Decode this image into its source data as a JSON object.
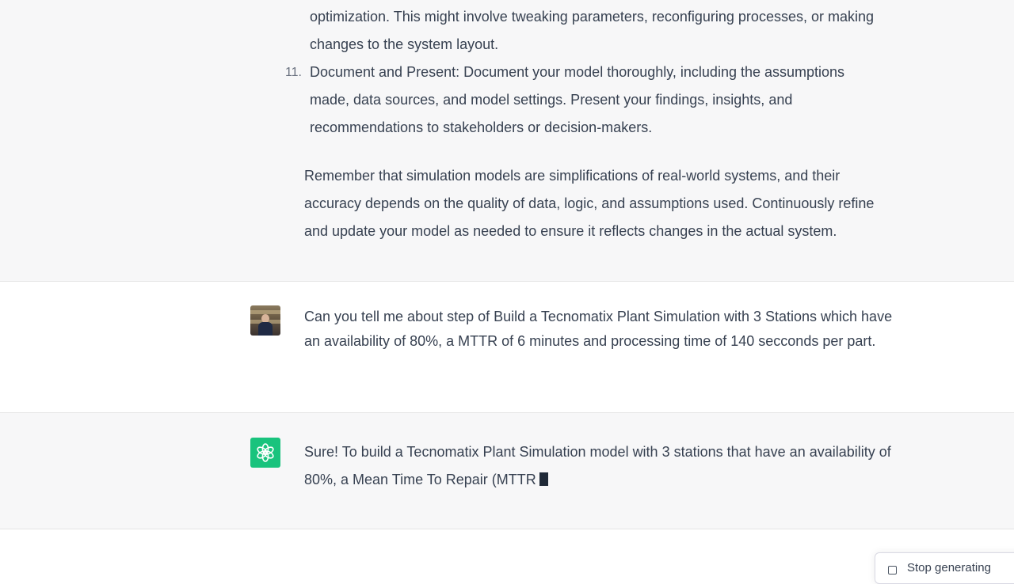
{
  "assistant_prev": {
    "item10_continuation": {
      "line1": "optimization. This might involve tweaking parameters, reconfiguring processes, or making",
      "line2": "changes to the system layout."
    },
    "item11": {
      "number": "11.",
      "line1": "Document and Present: Document your model thoroughly, including the assumptions",
      "line2": "made, data sources, and model settings. Present your findings, insights, and",
      "line3": "recommendations to stakeholders or decision-makers."
    },
    "closing": {
      "line1": "Remember that simulation models are simplifications of real-world systems, and their",
      "line2": "accuracy depends on the quality of data, logic, and assumptions used. Continuously refine",
      "line3": "and update your model as needed to ensure it reflects changes in the actual system."
    }
  },
  "user_message": {
    "line1": "Can you tell me about step of Build a Tecnomatix Plant Simulation with 3 Stations which have",
    "line2": "an availability of 80%, a MTTR of 6 minutes and processing time of 140 secconds per part."
  },
  "assistant_current": {
    "line1": "Sure! To build a Tecnomatix Plant Simulation model with 3 stations that have an availability of",
    "line2": "80%, a Mean Time To Repair (MTTR"
  },
  "stop_button": {
    "label": "Stop generating"
  },
  "icons": {
    "assistant_avatar": "openai-logo-icon",
    "stop": "stop-square-icon"
  },
  "colors": {
    "assistant_bg": "#f7f7f8",
    "user_bg": "#ffffff",
    "gpt_green": "#19c37d",
    "text": "#374151"
  }
}
